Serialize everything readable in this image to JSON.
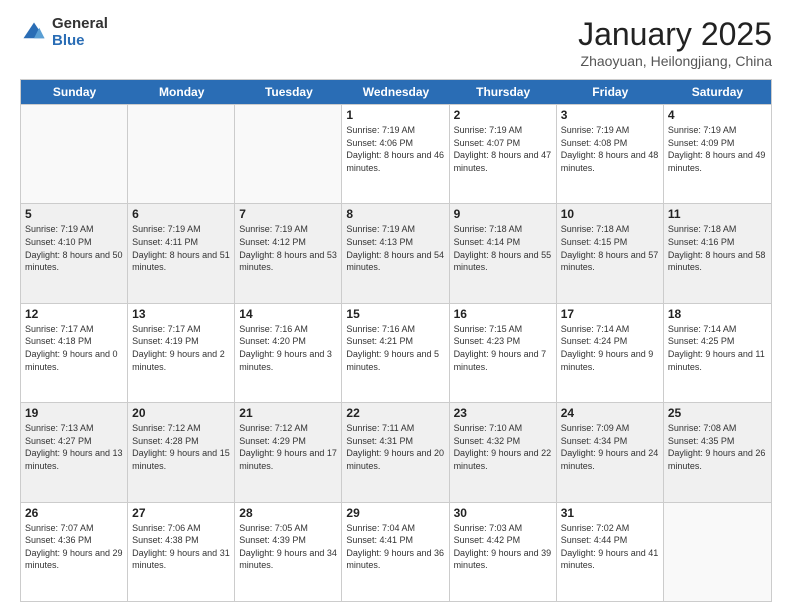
{
  "logo": {
    "general": "General",
    "blue": "Blue"
  },
  "header": {
    "title": "January 2025",
    "subtitle": "Zhaoyuan, Heilongjiang, China"
  },
  "days": [
    "Sunday",
    "Monday",
    "Tuesday",
    "Wednesday",
    "Thursday",
    "Friday",
    "Saturday"
  ],
  "rows": [
    [
      {
        "day": "",
        "sunrise": "",
        "sunset": "",
        "daylight": "",
        "empty": true
      },
      {
        "day": "",
        "sunrise": "",
        "sunset": "",
        "daylight": "",
        "empty": true
      },
      {
        "day": "",
        "sunrise": "",
        "sunset": "",
        "daylight": "",
        "empty": true
      },
      {
        "day": "1",
        "sunrise": "Sunrise: 7:19 AM",
        "sunset": "Sunset: 4:06 PM",
        "daylight": "Daylight: 8 hours and 46 minutes."
      },
      {
        "day": "2",
        "sunrise": "Sunrise: 7:19 AM",
        "sunset": "Sunset: 4:07 PM",
        "daylight": "Daylight: 8 hours and 47 minutes."
      },
      {
        "day": "3",
        "sunrise": "Sunrise: 7:19 AM",
        "sunset": "Sunset: 4:08 PM",
        "daylight": "Daylight: 8 hours and 48 minutes."
      },
      {
        "day": "4",
        "sunrise": "Sunrise: 7:19 AM",
        "sunset": "Sunset: 4:09 PM",
        "daylight": "Daylight: 8 hours and 49 minutes."
      }
    ],
    [
      {
        "day": "5",
        "sunrise": "Sunrise: 7:19 AM",
        "sunset": "Sunset: 4:10 PM",
        "daylight": "Daylight: 8 hours and 50 minutes."
      },
      {
        "day": "6",
        "sunrise": "Sunrise: 7:19 AM",
        "sunset": "Sunset: 4:11 PM",
        "daylight": "Daylight: 8 hours and 51 minutes."
      },
      {
        "day": "7",
        "sunrise": "Sunrise: 7:19 AM",
        "sunset": "Sunset: 4:12 PM",
        "daylight": "Daylight: 8 hours and 53 minutes."
      },
      {
        "day": "8",
        "sunrise": "Sunrise: 7:19 AM",
        "sunset": "Sunset: 4:13 PM",
        "daylight": "Daylight: 8 hours and 54 minutes."
      },
      {
        "day": "9",
        "sunrise": "Sunrise: 7:18 AM",
        "sunset": "Sunset: 4:14 PM",
        "daylight": "Daylight: 8 hours and 55 minutes."
      },
      {
        "day": "10",
        "sunrise": "Sunrise: 7:18 AM",
        "sunset": "Sunset: 4:15 PM",
        "daylight": "Daylight: 8 hours and 57 minutes."
      },
      {
        "day": "11",
        "sunrise": "Sunrise: 7:18 AM",
        "sunset": "Sunset: 4:16 PM",
        "daylight": "Daylight: 8 hours and 58 minutes."
      }
    ],
    [
      {
        "day": "12",
        "sunrise": "Sunrise: 7:17 AM",
        "sunset": "Sunset: 4:18 PM",
        "daylight": "Daylight: 9 hours and 0 minutes."
      },
      {
        "day": "13",
        "sunrise": "Sunrise: 7:17 AM",
        "sunset": "Sunset: 4:19 PM",
        "daylight": "Daylight: 9 hours and 2 minutes."
      },
      {
        "day": "14",
        "sunrise": "Sunrise: 7:16 AM",
        "sunset": "Sunset: 4:20 PM",
        "daylight": "Daylight: 9 hours and 3 minutes."
      },
      {
        "day": "15",
        "sunrise": "Sunrise: 7:16 AM",
        "sunset": "Sunset: 4:21 PM",
        "daylight": "Daylight: 9 hours and 5 minutes."
      },
      {
        "day": "16",
        "sunrise": "Sunrise: 7:15 AM",
        "sunset": "Sunset: 4:23 PM",
        "daylight": "Daylight: 9 hours and 7 minutes."
      },
      {
        "day": "17",
        "sunrise": "Sunrise: 7:14 AM",
        "sunset": "Sunset: 4:24 PM",
        "daylight": "Daylight: 9 hours and 9 minutes."
      },
      {
        "day": "18",
        "sunrise": "Sunrise: 7:14 AM",
        "sunset": "Sunset: 4:25 PM",
        "daylight": "Daylight: 9 hours and 11 minutes."
      }
    ],
    [
      {
        "day": "19",
        "sunrise": "Sunrise: 7:13 AM",
        "sunset": "Sunset: 4:27 PM",
        "daylight": "Daylight: 9 hours and 13 minutes."
      },
      {
        "day": "20",
        "sunrise": "Sunrise: 7:12 AM",
        "sunset": "Sunset: 4:28 PM",
        "daylight": "Daylight: 9 hours and 15 minutes."
      },
      {
        "day": "21",
        "sunrise": "Sunrise: 7:12 AM",
        "sunset": "Sunset: 4:29 PM",
        "daylight": "Daylight: 9 hours and 17 minutes."
      },
      {
        "day": "22",
        "sunrise": "Sunrise: 7:11 AM",
        "sunset": "Sunset: 4:31 PM",
        "daylight": "Daylight: 9 hours and 20 minutes."
      },
      {
        "day": "23",
        "sunrise": "Sunrise: 7:10 AM",
        "sunset": "Sunset: 4:32 PM",
        "daylight": "Daylight: 9 hours and 22 minutes."
      },
      {
        "day": "24",
        "sunrise": "Sunrise: 7:09 AM",
        "sunset": "Sunset: 4:34 PM",
        "daylight": "Daylight: 9 hours and 24 minutes."
      },
      {
        "day": "25",
        "sunrise": "Sunrise: 7:08 AM",
        "sunset": "Sunset: 4:35 PM",
        "daylight": "Daylight: 9 hours and 26 minutes."
      }
    ],
    [
      {
        "day": "26",
        "sunrise": "Sunrise: 7:07 AM",
        "sunset": "Sunset: 4:36 PM",
        "daylight": "Daylight: 9 hours and 29 minutes."
      },
      {
        "day": "27",
        "sunrise": "Sunrise: 7:06 AM",
        "sunset": "Sunset: 4:38 PM",
        "daylight": "Daylight: 9 hours and 31 minutes."
      },
      {
        "day": "28",
        "sunrise": "Sunrise: 7:05 AM",
        "sunset": "Sunset: 4:39 PM",
        "daylight": "Daylight: 9 hours and 34 minutes."
      },
      {
        "day": "29",
        "sunrise": "Sunrise: 7:04 AM",
        "sunset": "Sunset: 4:41 PM",
        "daylight": "Daylight: 9 hours and 36 minutes."
      },
      {
        "day": "30",
        "sunrise": "Sunrise: 7:03 AM",
        "sunset": "Sunset: 4:42 PM",
        "daylight": "Daylight: 9 hours and 39 minutes."
      },
      {
        "day": "31",
        "sunrise": "Sunrise: 7:02 AM",
        "sunset": "Sunset: 4:44 PM",
        "daylight": "Daylight: 9 hours and 41 minutes."
      },
      {
        "day": "",
        "sunrise": "",
        "sunset": "",
        "daylight": "",
        "empty": true
      }
    ]
  ]
}
